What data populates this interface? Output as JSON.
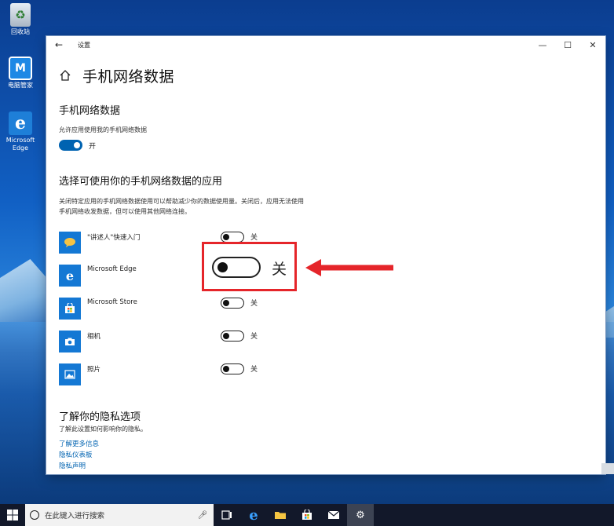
{
  "desktop": {
    "icons": [
      {
        "label": "回收站",
        "icon": "recycle-bin-icon"
      },
      {
        "label": "电脑管家",
        "icon": "pc-manager-icon"
      },
      {
        "label": "Microsoft Edge",
        "icon": "edge-icon"
      }
    ]
  },
  "window": {
    "title": "设置",
    "controls": {
      "minimize": "—",
      "maximize": "☐",
      "close": "✕"
    },
    "back": "←"
  },
  "page": {
    "title": "手机网络数据",
    "section1": {
      "title": "手机网络数据",
      "allow_label": "允许应用使用我的手机网络数据",
      "toggle_state": "开"
    },
    "section2": {
      "title": "选择可使用你的手机网络数据的应用",
      "description": "关闭特定应用的手机网络数据使用可以帮助减少你的数据使用量。关闭后，应用无法使用手机网络收发数据，但可以使用其他网络连接。",
      "apps": [
        {
          "name": "\"讲述人\"快速入门",
          "state": "关",
          "icon": "narrator-icon"
        },
        {
          "name": "Microsoft Edge",
          "state": "关",
          "icon": "edge-icon"
        },
        {
          "name": "Microsoft Store",
          "state": "关",
          "icon": "store-icon"
        },
        {
          "name": "相机",
          "state": "关",
          "icon": "camera-icon"
        },
        {
          "name": "照片",
          "state": "关",
          "icon": "photos-icon"
        }
      ]
    },
    "section3": {
      "title": "了解你的隐私选项",
      "description": "了解此设置如何影响你的隐私。",
      "links": [
        "了解更多信息",
        "隐私仪表板",
        "隐私声明"
      ]
    }
  },
  "annotation": {
    "highlight_label": "关"
  },
  "taskbar": {
    "search_placeholder": "在此键入进行搜索"
  },
  "colors": {
    "accent": "#0063b1",
    "highlight_border": "#e5252a",
    "taskbar": "#12182a"
  }
}
